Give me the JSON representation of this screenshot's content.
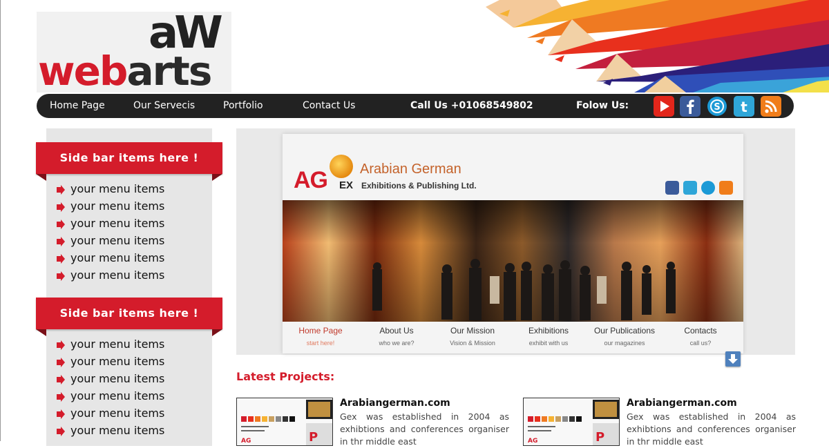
{
  "brand": {
    "logo_top": "aW",
    "logo_bottom_web": "web",
    "logo_bottom_arts": "arts"
  },
  "nav": {
    "items": [
      "Home Page",
      "Our Servecis",
      "Portfolio",
      "Contact Us"
    ],
    "call": "Call Us +01068549802",
    "follow": "Folow Us:",
    "social": [
      "youtube-icon",
      "facebook-icon",
      "skype-icon",
      "twitter-icon",
      "rss-icon"
    ]
  },
  "sidebar": {
    "sections": [
      {
        "title": "Side bar items here !",
        "items": [
          "your menu items",
          "your menu items",
          "your menu items",
          "your menu items",
          "your menu items",
          "your menu items"
        ]
      },
      {
        "title": "Side bar items here !",
        "items": [
          "your menu items",
          "your menu items",
          "your menu items",
          "your menu items",
          "your menu items",
          "your menu items"
        ]
      }
    ]
  },
  "preview": {
    "company": "Arabian German",
    "subtitle": "Exhibitions & Publishing Ltd.",
    "logo_ag": "AG",
    "logo_ex": "EX",
    "nav": [
      {
        "t": "Home Page",
        "s": "start here!"
      },
      {
        "t": "About Us",
        "s": "who we are?"
      },
      {
        "t": "Our Mission",
        "s": "Vision & Mission"
      },
      {
        "t": "Exhibitions",
        "s": "exhibit with us"
      },
      {
        "t": "Our Publications",
        "s": "our magazines"
      },
      {
        "t": "Contacts",
        "s": "call us?"
      }
    ]
  },
  "latest": {
    "heading": "Latest Projects:",
    "projects": [
      {
        "title": "Arabiangerman.com",
        "desc": "Gex was established in 2004 as exhibtions and conferences organiser in thr middle east"
      },
      {
        "title": "Arabiangerman.com",
        "desc": "Gex was established in 2004 as exhibtions and conferences organiser in thr middle east"
      }
    ]
  },
  "colors": {
    "brand_red": "#d41c2b",
    "nav_bg": "#222222",
    "sidebar_bg": "#e6e6e6"
  }
}
